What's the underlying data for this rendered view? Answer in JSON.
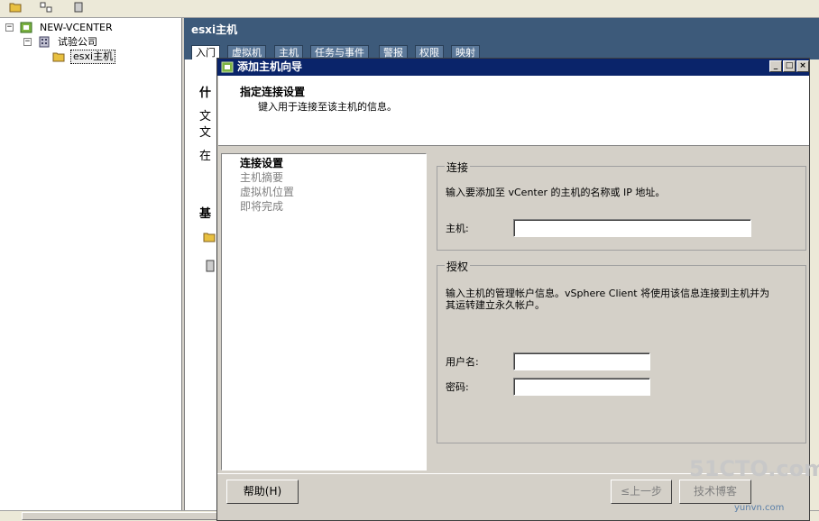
{
  "tree": {
    "root_label": "NEW-VCENTER",
    "datacenter_label": "试验公司",
    "folder_label": "esxi主机",
    "expander_minus": "−"
  },
  "right_panel": {
    "header": "esxi主机",
    "tabs": [
      "入门",
      "虚拟机",
      "主机",
      "任务与事件",
      "警报",
      "权限",
      "映射"
    ],
    "bg_texts": [
      "什",
      "文",
      "文",
      "在",
      "基"
    ]
  },
  "dialog": {
    "title": "添加主机向导",
    "banner_title": "指定连接设置",
    "banner_sub": "键入用于连接至该主机的信息。",
    "steps": [
      "连接设置",
      "主机摘要",
      "虚拟机位置",
      "即将完成"
    ],
    "connection": {
      "legend": "连接",
      "desc": "输入要添加至 vCenter 的主机的名称或 IP 地址。",
      "host_label": "主机:",
      "host_value": ""
    },
    "auth": {
      "legend": "授权",
      "desc_line1": "输入主机的管理帐户信息。vSphere Client 将使用该信息连接到主机并为",
      "desc_line2": "其运转建立永久帐户。",
      "username_label": "用户名:",
      "username_value": "",
      "password_label": "密码:",
      "password_value": ""
    },
    "buttons": {
      "help": "帮助(H)",
      "back": "≤上一步",
      "next": "技术博客"
    }
  },
  "watermark": {
    "main": "51CTO.com",
    "sub": "yunvn.com"
  }
}
